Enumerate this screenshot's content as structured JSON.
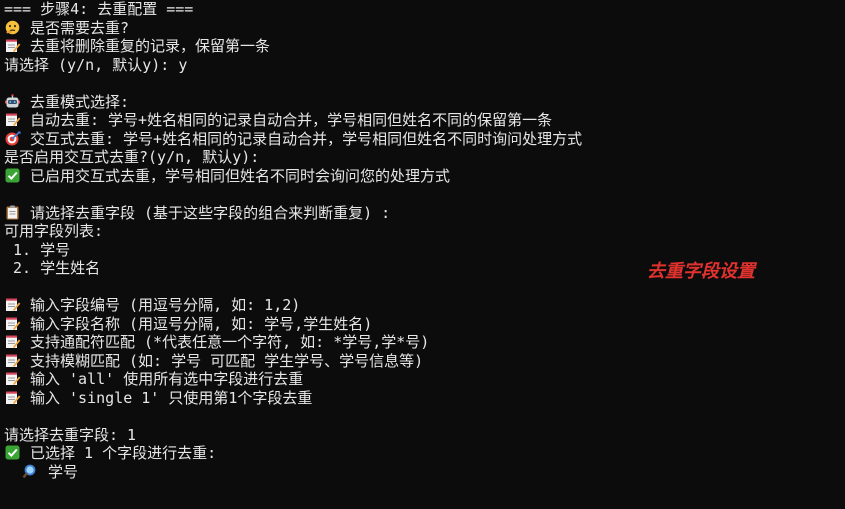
{
  "terminal": {
    "step_header": "=== 步骤4: 去重配置 ===",
    "ask_need_dedup": "是否需要去重?",
    "dedup_desc": "去重将删除重复的记录，保留第一条",
    "prompt_dedup": "请选择 (y/n, 默认y): y",
    "mode_title": "去重模式选择:",
    "mode_auto": "自动去重: 学号+姓名相同的记录自动合并，学号相同但姓名不同的保留第一条",
    "mode_interactive": "交互式去重: 学号+姓名相同的记录自动合并，学号相同但姓名不同时询问处理方式",
    "prompt_interactive": "是否启用交互式去重?(y/n, 默认y):",
    "interactive_enabled": "已启用交互式去重，学号相同但姓名不同时会询问您的处理方式",
    "field_select_title": "请选择去重字段 (基于这些字段的组合来判断重复) :",
    "available_fields_title": "可用字段列表:",
    "fields": [
      " 1. 学号",
      " 2. 学生姓名"
    ],
    "hints": [
      "输入字段编号 (用逗号分隔, 如: 1,2)",
      "输入字段名称 (用逗号分隔, 如: 学号,学生姓名)",
      "支持通配符匹配 (*代表任意一个字符, 如: *学号,学*号)",
      "支持模糊匹配 (如: 学号 可匹配 学生学号、学号信息等)",
      "输入 'all' 使用所有选中字段进行去重",
      "输入 'single 1' 只使用第1个字段去重"
    ],
    "prompt_field": "请选择去重字段: 1",
    "selected_msg": "已选择 1 个字段进行去重:",
    "selected_fields": [
      "学号"
    ]
  },
  "annotation": "去重字段设置",
  "colors": {
    "background": "#0c0c0c",
    "text": "#e6e6e6",
    "annotation": "#e0322e",
    "check_green": "#3aa535",
    "memo_pink": "#d8455c"
  },
  "icons": {
    "thinking": "thinking-face-icon",
    "memo": "memo-icon",
    "robot": "robot-icon",
    "target": "direct-hit-icon",
    "check": "check-mark-button-icon",
    "clipboard": "clipboard-icon",
    "magnifier": "magnifying-glass-icon"
  }
}
